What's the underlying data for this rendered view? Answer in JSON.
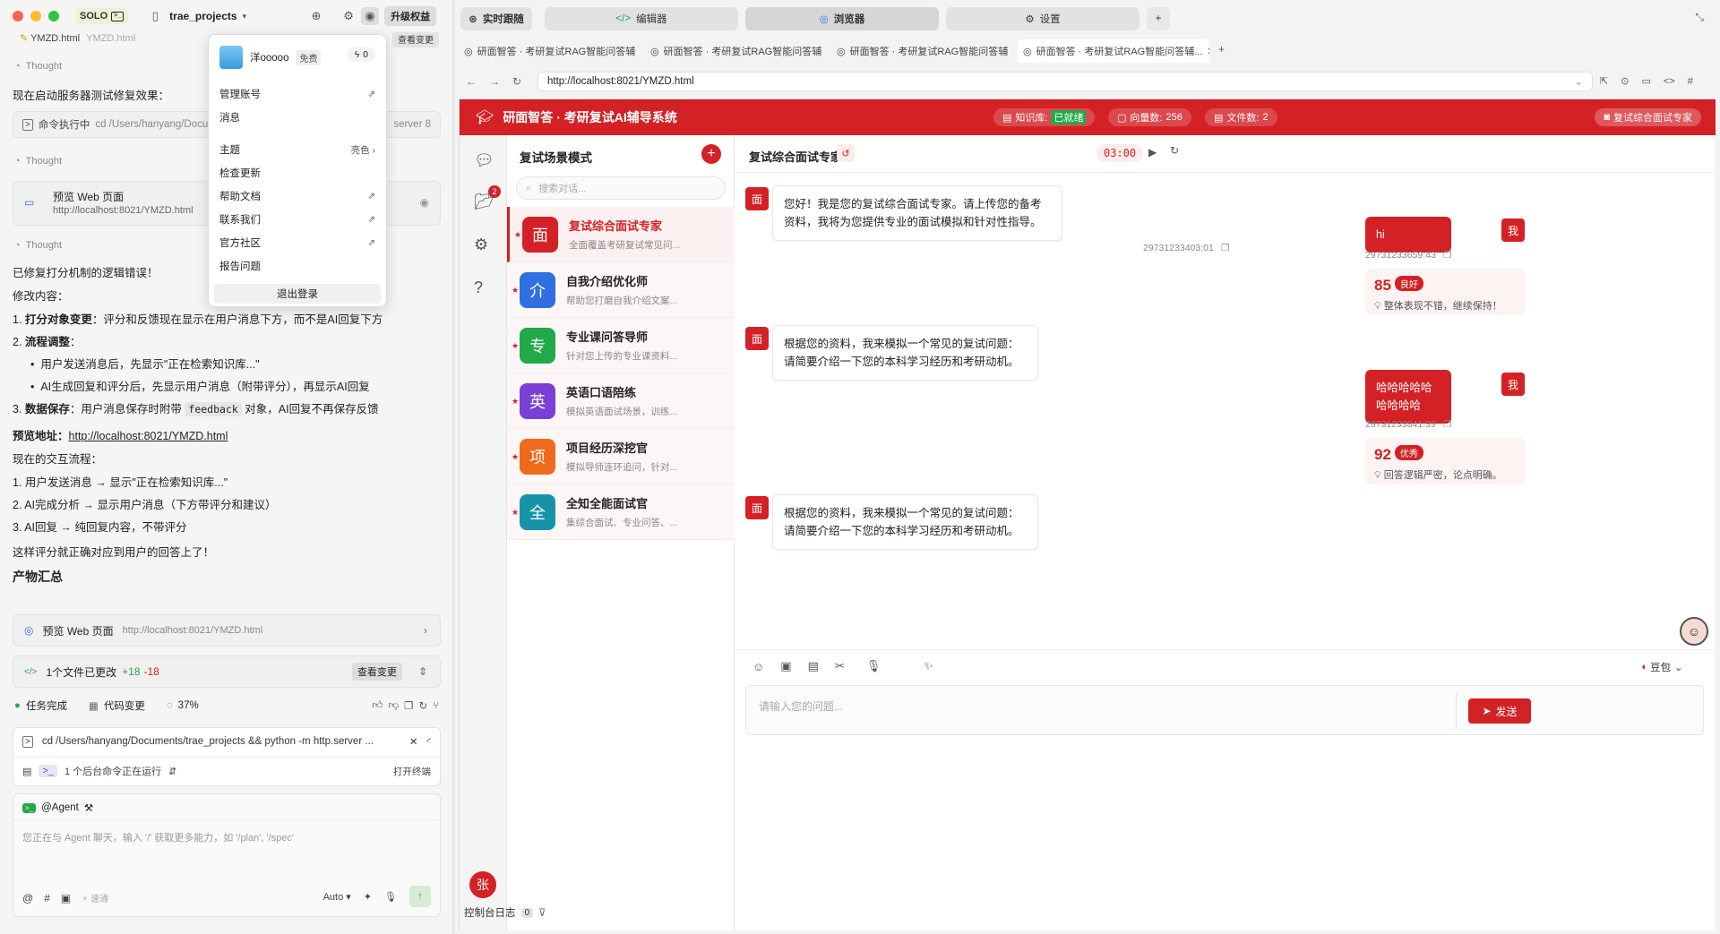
{
  "window": {
    "solo": "SOLO",
    "project": "trae_projects",
    "upgrade": "升级权益"
  },
  "leftchat": {
    "top_file": "YMZD.html",
    "top_file_path": "YMZD.html",
    "top_file_action": "查看变更",
    "thought": "Thought",
    "start_server": "现在启动服务器测试修复效果：",
    "cmd_label": "命令执行中",
    "cmd_text": "cd /Users/hanyang/Docum",
    "cmd_tail": "server 8",
    "preview_title": "预览 Web 页面",
    "preview_url": "http://localhost:8021/YMZD.html",
    "fixed": "已修复打分机制的逻辑错误！",
    "changes_title": "修改内容：",
    "c1_num": "1. ",
    "c1_bold": "打分对象变更",
    "c1_text": "：评分和反馈现在显示在用户消息下方，而不是AI回复下方",
    "c2_num": "2. ",
    "c2_bold": "流程调整",
    "c2_text": "：",
    "c2_b1": "用户发送消息后，先显示\"正在检索知识库...\"",
    "c2_b2": "AI生成回复和评分后，先显示用户消息（附带评分），再显示AI回复",
    "c3_num": "3. ",
    "c3_bold": "数据保存",
    "c3_text": "：用户消息保存时附带 ",
    "c3_code": "feedback",
    "c3_text2": " 对象，AI回复不再保存反馈",
    "preview_addr_label": "预览地址：",
    "preview_addr": "http://localhost:8021/YMZD.html",
    "flow_title": "现在的交互流程：",
    "f1": "1. 用户发送消息 → 显示\"正在检索知识库...\"",
    "f2": "2. AI完成分析 → 显示用户消息（下方带评分和建议）",
    "f3": "3. AI回复 → 纯回复内容，不带评分",
    "summary": "这样评分就正确对应到用户的回答上了！",
    "artifacts": "产物汇总",
    "art_preview": "预览 Web 页面",
    "art_preview_url": "http://localhost:8021/YMZD.html",
    "art_files": "1个文件已更改",
    "art_add": "+18",
    "art_del": "-18",
    "art_view": "查看变更",
    "status_done": "任务完成",
    "status_code": "代码变更",
    "status_pct": "37%",
    "term_cmd": "cd /Users/hanyang/Documents/trae_projects && python -m http.server ...",
    "term_bg": "1 个后台命令正在运行",
    "term_open": "打开终端",
    "agent": "@Agent",
    "input_placeholder": "您正在与 Agent 聊天，输入 '/' 获取更多能力，如 '/plan', '/spec'",
    "speed": "速通",
    "auto": "Auto"
  },
  "dropdown": {
    "user": "洋ooooo",
    "plan": "免费",
    "credits": "0",
    "items": [
      "管理账号",
      "消息",
      "主题",
      "检查更新",
      "帮助文档",
      "联系我们",
      "官方社区",
      "报告问题"
    ],
    "theme_value": "亮色",
    "logout": "退出登录"
  },
  "panel_tabs": [
    "实时跟随",
    "编辑器",
    "浏览器",
    "设置"
  ],
  "browser_tabs": [
    "研面智答 · 考研复试RAG智能问答辅...",
    "研面智答 · 考研复试RAG智能问答辅...",
    "研面智答 · 考研复试RAG智能问答辅...",
    "研面智答 · 考研复试RAG智能问答辅..."
  ],
  "url": "http://localhost:8021/YMZD.html",
  "app": {
    "title": "研面智答 · 考研复试AI辅导系统",
    "kb_label": "知识库:",
    "kb_status": "已就绪",
    "vec_label": "向量数:",
    "vec_count": "256",
    "doc_label": "文件数:",
    "doc_count": "2",
    "expert_btn": "复试综合面试专家",
    "folder_badge": "2",
    "scenes_title": "复试场景模式",
    "search_placeholder": "搜索对话...",
    "scenes": [
      {
        "icon": "面",
        "name": "复试综合面试专家",
        "desc": "全面覆盖考研复试常见问...",
        "color": "#d42125"
      },
      {
        "icon": "介",
        "name": "自我介绍优化师",
        "desc": "帮助您打磨自我介绍文案...",
        "color": "#2f6fe0"
      },
      {
        "icon": "专",
        "name": "专业课问答导师",
        "desc": "针对您上传的专业课资料...",
        "color": "#22a94a"
      },
      {
        "icon": "英",
        "name": "英语口语陪练",
        "desc": "模拟英语面试场景，训练...",
        "color": "#7b3fd6"
      },
      {
        "icon": "项",
        "name": "项目经历深挖官",
        "desc": "模拟导师连环追问，针对...",
        "color": "#ef6a1a"
      },
      {
        "icon": "全",
        "name": "全知全能面试官",
        "desc": "集综合面试、专业问答、...",
        "color": "#1693a8"
      }
    ],
    "user_avatar": "张",
    "chat_title": "复试综合面试专家",
    "timer": "03:00",
    "messages": {
      "bot1": "您好！我是您的复试综合面试专家。请上传您的备考资料，我将为您提供专业的面试模拟和针对性指导。",
      "bot1_ts": "29731233403:01",
      "u1": "hi",
      "u1_ts": "29731233659:43",
      "s1": "85",
      "s1_lv": "良好",
      "s1_fb": "整体表现不错，继续保持！",
      "bot2": "根据您的资料，我来模拟一个常见的复试问题：请简要介绍一下您的本科学习经历和考研动机。",
      "u2": "哈哈哈哈哈哈哈哈哈",
      "u2_ts": "29731233841:39",
      "s2": "92",
      "s2_lv": "优秀",
      "s2_fb": "回答逻辑严密，论点明确。",
      "bot3": "根据您的资料，我来模拟一个常见的复试问题：请简要介绍一下您的本科学习经历和考研动机。",
      "bot_icon": "面",
      "user_icon": "我"
    },
    "model": "豆包",
    "input_placeholder": "请输入您的问题...",
    "send": "发送"
  },
  "console": {
    "label": "控制台日志",
    "count": "0"
  }
}
